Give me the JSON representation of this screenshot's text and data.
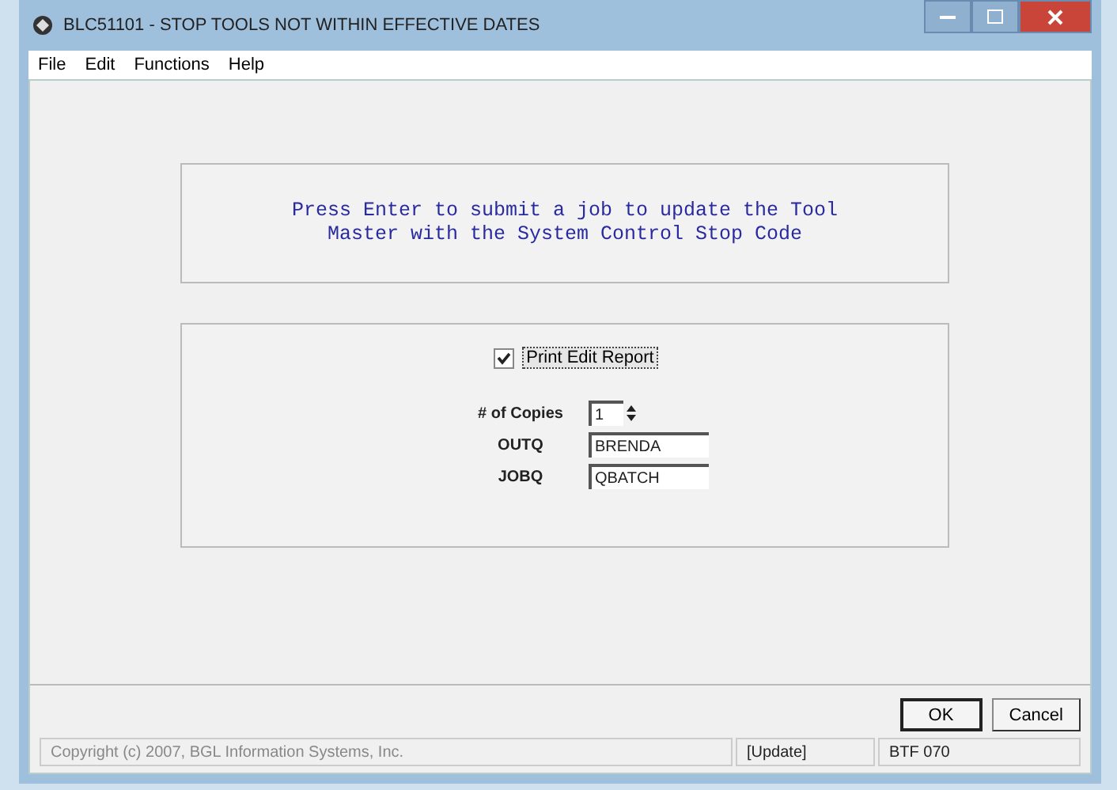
{
  "window": {
    "title": "BLC51101 - STOP TOOLS NOT WITHIN EFFECTIVE DATES"
  },
  "menu": [
    "File",
    "Edit",
    "Functions",
    "Help"
  ],
  "message": "Press Enter to submit a job to update the Tool\nMaster with the System Control Stop Code",
  "print_edit_report": {
    "label": "Print Edit Report",
    "checked": true
  },
  "fields": [
    {
      "label": "# of Copies",
      "value": "1",
      "kind": "spinner"
    },
    {
      "label": "OUTQ",
      "value": "BRENDA",
      "kind": "text"
    },
    {
      "label": "JOBQ",
      "value": "QBATCH",
      "kind": "text"
    }
  ],
  "buttons": [
    {
      "label": "OK",
      "default": true
    },
    {
      "label": "Cancel",
      "default": false
    }
  ],
  "status_bar": [
    "Copyright (c) 2007, BGL Information Systems, Inc.",
    "[Update]",
    "BTF 070"
  ]
}
